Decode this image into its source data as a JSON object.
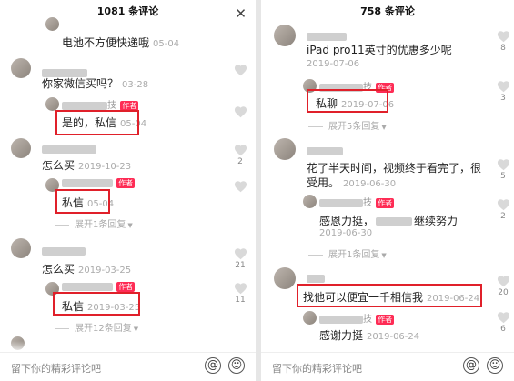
{
  "left": {
    "title": "1081 条评论",
    "close": "✕",
    "c0": {
      "reply_text": "电池不方便快递哦",
      "time": "05-04"
    },
    "c1": {
      "text": "你家微信买吗？",
      "time": "03-28",
      "reply_name_tail": "技",
      "badge": "作者",
      "reply_text": "是的，私信",
      "reply_time": "05-04"
    },
    "c2": {
      "text": "怎么买",
      "time": "2019-10-23",
      "likes": "2",
      "badge": "作者",
      "reply_text": "私信",
      "reply_time": "05-04",
      "expand": "展开1条回复"
    },
    "c3": {
      "text": "怎么买",
      "time": "2019-03-25",
      "likes": "21",
      "badge": "作者",
      "reply_text": "私信",
      "reply_time": "2019-03-25",
      "reply_likes": "11",
      "expand": "展开12条回复"
    },
    "input_placeholder": "留下你的精彩评论吧",
    "at": "@",
    "emoji": "☺"
  },
  "right": {
    "title": "758 条评论",
    "c0": {
      "text": "iPad pro11英寸的优惠多少呢",
      "time": "2019-07-06",
      "likes": "8",
      "reply_name_tail": "技",
      "badge": "作者",
      "reply_text": "私聊",
      "reply_time": "2019-07-06",
      "reply_likes": "3",
      "expand": "展开5条回复"
    },
    "c1": {
      "text_line1": "花了半天时间，视频终于看完了，很",
      "text_line2": "受用。",
      "time": "2019-06-30",
      "likes": "5",
      "reply_name_tail": "技",
      "badge": "作者",
      "reply_text_a": "感恩力挺，",
      "reply_text_b": "继续努力",
      "reply_time": "2019-06-30",
      "reply_likes": "2",
      "expand": "展开1条回复"
    },
    "c2": {
      "text": "找他可以便宜一千相信我",
      "time": "2019-06-24",
      "likes": "20",
      "reply_name_tail": "技",
      "badge": "作者",
      "reply_text": "感谢力挺",
      "reply_time": "2019-06-24",
      "reply_likes": "6"
    },
    "input_placeholder": "留下你的精彩评论吧",
    "at": "@",
    "emoji": "☺"
  }
}
